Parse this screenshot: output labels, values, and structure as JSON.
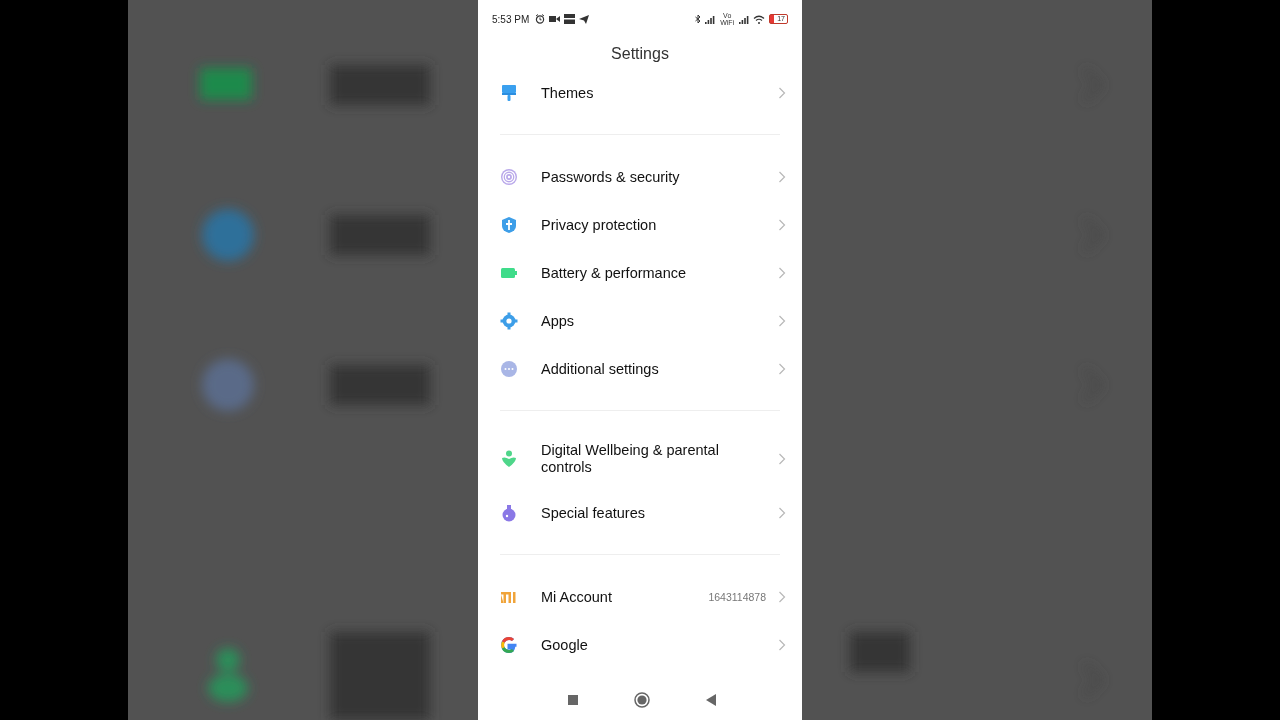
{
  "status_bar": {
    "time": "5:53 PM",
    "vowifi_label": "Vo WiFi",
    "battery_percent": "17"
  },
  "header": {
    "title": "Settings"
  },
  "groups": [
    {
      "items": [
        {
          "label": "Themes",
          "kind": "brush"
        }
      ]
    },
    {
      "items": [
        {
          "label": "Passwords & security",
          "kind": "fingerprint"
        },
        {
          "label": "Privacy protection",
          "kind": "shield"
        },
        {
          "label": "Battery & performance",
          "kind": "battery"
        },
        {
          "label": "Apps",
          "kind": "gear"
        },
        {
          "label": "Additional settings",
          "kind": "dots"
        }
      ]
    },
    {
      "items": [
        {
          "label": "Digital Wellbeing & parental controls",
          "kind": "wellbeing"
        },
        {
          "label": "Special features",
          "kind": "flask"
        }
      ]
    },
    {
      "items": [
        {
          "label": "Mi Account",
          "kind": "mi",
          "value": "1643114878"
        },
        {
          "label": "Google",
          "kind": "google"
        }
      ]
    }
  ]
}
